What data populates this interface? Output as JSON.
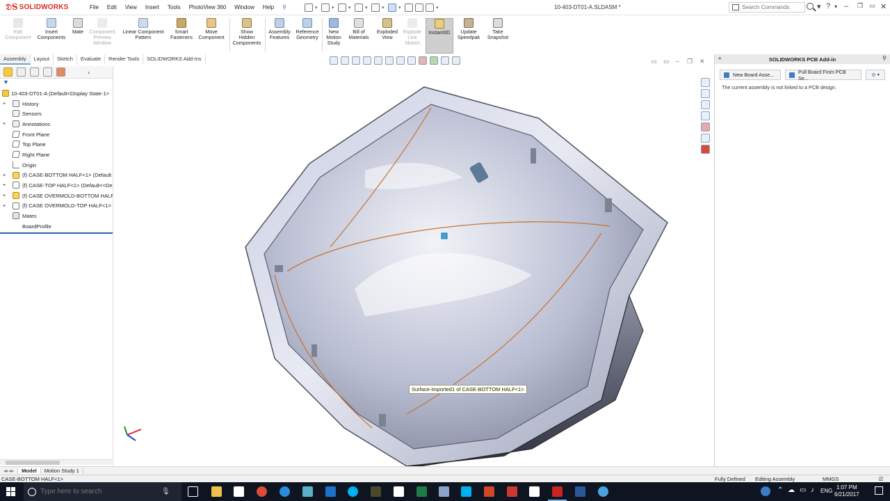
{
  "app": {
    "brand": "SOLIDWORKS",
    "document_title": "10-403-DT01-A.SLDASM *",
    "menus": [
      "File",
      "Edit",
      "View",
      "Insert",
      "Tools",
      "PhotoView 360",
      "Window",
      "Help"
    ],
    "search": {
      "placeholder": "Search Commands"
    }
  },
  "ribbon": {
    "buttons": [
      {
        "label": "Edit\nComponent",
        "icon": "edit-component-icon",
        "enabled": false
      },
      {
        "label": "Insert\nComponents",
        "icon": "insert-components-icon",
        "enabled": true
      },
      {
        "label": "Mate",
        "icon": "mate-icon",
        "enabled": true
      },
      {
        "label": "Component\nPreview\nWindow",
        "icon": "component-preview-icon",
        "enabled": false
      },
      {
        "label": "Linear Component\nPattern",
        "icon": "pattern-icon",
        "enabled": true
      },
      {
        "label": "Smart\nFasteners",
        "icon": "fastener-icon",
        "enabled": true
      },
      {
        "label": "Move\nComponent",
        "icon": "move-component-icon",
        "enabled": true
      },
      {
        "label": "Show\nHidden\nComponents",
        "icon": "show-hidden-icon",
        "enabled": true
      },
      {
        "label": "Assembly\nFeatures",
        "icon": "assembly-features-icon",
        "enabled": true
      },
      {
        "label": "Reference\nGeometry",
        "icon": "reference-geometry-icon",
        "enabled": true
      },
      {
        "label": "New\nMotion\nStudy",
        "icon": "motion-study-icon",
        "enabled": true
      },
      {
        "label": "Bill of\nMaterials",
        "icon": "bom-icon",
        "enabled": true
      },
      {
        "label": "Exploded\nView",
        "icon": "exploded-view-icon",
        "enabled": true
      },
      {
        "label": "Explode\nLine\nSketch",
        "icon": "explode-line-icon",
        "enabled": false
      },
      {
        "label": "Instant3D",
        "icon": "instant3d-icon",
        "enabled": true,
        "active": true
      },
      {
        "label": "Update\nSpeedpak",
        "icon": "speedpak-icon",
        "enabled": true
      },
      {
        "label": "Take\nSnapshot",
        "icon": "snapshot-icon",
        "enabled": true
      }
    ]
  },
  "tabs": [
    "Assembly",
    "Layout",
    "Sketch",
    "Evaluate",
    "Render Tools",
    "SOLIDWORKS Add-Ins"
  ],
  "active_tab": "Assembly",
  "feature_tree": {
    "root": "10-403-DT01-A  (Default<Display State-1>",
    "items": [
      {
        "label": "History",
        "icon": "history-icon",
        "expandable": true
      },
      {
        "label": "Sensors",
        "icon": "sensors-icon",
        "expandable": false
      },
      {
        "label": "Annotations",
        "icon": "annotations-icon",
        "expandable": true
      },
      {
        "label": "Front Plane",
        "icon": "plane-icon",
        "expandable": false
      },
      {
        "label": "Top Plane",
        "icon": "plane-icon",
        "expandable": false
      },
      {
        "label": "Right Plane",
        "icon": "plane-icon",
        "expandable": false
      },
      {
        "label": "Origin",
        "icon": "origin-icon",
        "expandable": false
      },
      {
        "label": "(f) CASE-BOTTOM HALF<1> (Default",
        "icon": "part-icon",
        "expandable": true
      },
      {
        "label": "(f) CASE-TOP HALF<1> (Default<<De",
        "icon": "part-hidden-icon",
        "expandable": true
      },
      {
        "label": "(f) CASE OVERMOLD-BOTTOM HALF",
        "icon": "part-icon",
        "expandable": true
      },
      {
        "label": "(f) CASE OVERMOLD-TOP HALF<1> (",
        "icon": "part-hidden-icon",
        "expandable": true
      },
      {
        "label": "Mates",
        "icon": "mates-icon",
        "expandable": false
      },
      {
        "label": "BoardProfile",
        "icon": "",
        "expandable": false
      }
    ]
  },
  "bottom_tabs": [
    "Model",
    "Motion Study 1"
  ],
  "viewport": {
    "tooltip": "Surface-Imported1 of CASE-BOTTOM HALF<1>"
  },
  "addin_pane": {
    "title": "SOLIDWORKS PCB Add-in",
    "buttons": [
      "New Board Asse...",
      "Pull Board From PCB Se..."
    ],
    "message": "The current assembly is not linked to a PCB design."
  },
  "status_bar": {
    "selection": "CASE-BOTTOM HALF<1>",
    "definition": "Fully Defined",
    "mode": "Editing Assembly",
    "units": "MMGS"
  },
  "taskbar": {
    "search_placeholder": "Type here to search",
    "language": "ENG",
    "time": "1:07 PM",
    "date": "6/21/2017"
  }
}
